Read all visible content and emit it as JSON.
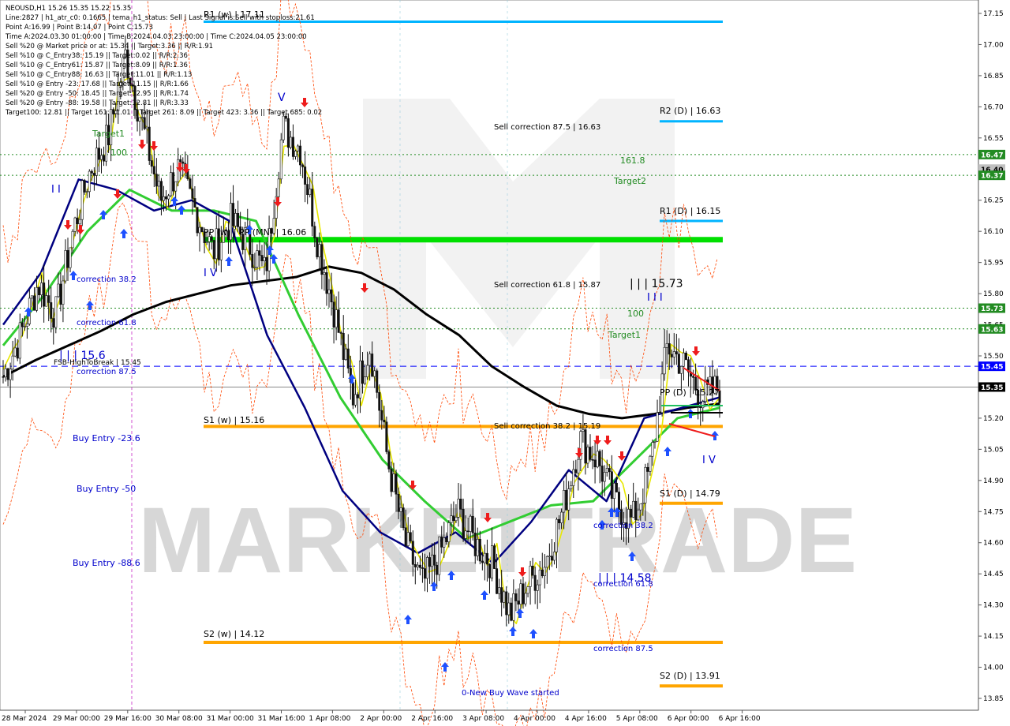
{
  "window": {
    "title": "NEOUSD,H1  15.26 15.35 15.22 15.35"
  },
  "info_lines": [
    "NEOUSD,H1  15.26 15.35 15.22 15.35",
    "Line:2827 | h1_atr_c0: 0.1665 | tema_h1_status: Sell | Last Signal is:Sell with stoploss:21.61",
    "Point A:16.99 | Point B:14.07 | Point C:15.73",
    "Time A:2024.03.30 01:00:00 | Time B:2024.04.03 23:00:00 | Time C:2024.04.05 23:00:00",
    "Sell %20 @ Market price or at: 15.34 || Target:3.36 || R/R:1.91",
    "Sell %10 @ C_Entry38: 15.19 || Target:0.02 || R/R:2.36",
    "Sell %10 @ C_Entry61: 15.87 || Target:8.09 || R/R:1.36",
    "Sell %10 @ C_Entry88: 16.63 || Target:11.01 || R/R:1.13",
    "Sell %10 @ Entry -23: 17.68 || Target:11.15 || R/R:1.66",
    "Sell %20 @ Entry -50: 18.45 || Target:12.95 || R/R:1.74",
    "Sell %20 @ Entry -88: 19.58 || Target:12.81 || R/R:3.33",
    "Target100: 12.81 || Target 161: 11.01 || Target 261: 8.09 || Target 423: 3.36 || Target 685: 0.02"
  ],
  "watermark": "MARKETTRADE",
  "colors": {
    "up": "#1a1a1a",
    "bg": "#ffffff",
    "orange": "#ffa500",
    "cyan": "#00b4ff",
    "green": "#00e000",
    "blue_label": "#0000cc",
    "green_label": "#228b22",
    "dashed_blue": "#0000ff",
    "ma_black": "#000000",
    "ma_navy": "#000080",
    "ma_green": "#32cd32",
    "ma_yellow": "#ffff00",
    "atr": "#ff4500"
  },
  "chart_data": {
    "type": "candlestick",
    "symbol": "NEOUSD",
    "timeframe": "H1",
    "ylim": [
      13.8,
      17.2
    ],
    "y_ticks": [
      "17.15",
      "17.00",
      "16.85",
      "16.70",
      "16.55",
      "16.40",
      "16.25",
      "16.10",
      "15.95",
      "15.80",
      "15.65",
      "15.50",
      "15.35",
      "15.20",
      "15.05",
      "14.90",
      "14.75",
      "14.60",
      "14.45",
      "14.30",
      "14.15",
      "14.00",
      "13.85"
    ],
    "x_ticks": [
      "28 Mar 2024",
      "29 Mar 00:00",
      "29 Mar 16:00",
      "30 Mar 08:00",
      "31 Mar 00:00",
      "31 Mar 16:00",
      "1 Apr 08:00",
      "2 Apr 00:00",
      "2 Apr 16:00",
      "3 Apr 08:00",
      "4 Apr 00:00",
      "4 Apr 16:00",
      "5 Apr 08:00",
      "6 Apr 00:00",
      "6 Apr 16:00"
    ],
    "price_tags": [
      {
        "text": "16.47",
        "value": 16.47,
        "color": "#228b22"
      },
      {
        "text": "16.40",
        "value": 16.4,
        "color": "#c0c0c0"
      },
      {
        "text": "16.37",
        "value": 16.37,
        "color": "#228b22"
      },
      {
        "text": "15.73",
        "value": 15.73,
        "color": "#228b22"
      },
      {
        "text": "15.63",
        "value": 15.63,
        "color": "#228b22"
      },
      {
        "text": "15.45",
        "value": 15.45,
        "color": "#0000ff"
      },
      {
        "text": "15.35",
        "value": 15.35,
        "color": "#000000"
      }
    ],
    "levels": [
      {
        "label": "R1 (w) | 17.11",
        "value": 17.11,
        "color": "#00b4ff"
      },
      {
        "label": "R2 (D) | 16.63",
        "value": 16.63,
        "color": "#00b4ff"
      },
      {
        "label": "R1 (D) | 16.15",
        "value": 16.15,
        "color": "#00b4ff"
      },
      {
        "label": "PP (w) | PP (MN) | 16.06",
        "value": 16.06,
        "color": "#00e000"
      },
      {
        "label": "S1 (w) | 15.16",
        "value": 15.16,
        "color": "#ffa500"
      },
      {
        "label": "S1 (D) | 14.79",
        "value": 14.79,
        "color": "#ffa500"
      },
      {
        "label": "S2 (w) | 14.12",
        "value": 14.12,
        "color": "#ffa500"
      },
      {
        "label": "S2 (D) | 13.91",
        "value": 13.91,
        "color": "#ffa500"
      }
    ],
    "dotted_levels": [
      16.47,
      16.37,
      15.73,
      15.63
    ],
    "dashed_level": 15.45,
    "current_price": 15.35,
    "annotations": {
      "sell_corr_875": "Sell correction 87.5 | 16.63",
      "sell_corr_618": "Sell correction 61.8 | 15.87",
      "sell_corr_382": "Sell correction 38.2 | 15.19",
      "target1_left": "Target1",
      "label_100_left": "100",
      "fib_1618": "161.8",
      "target2": "Target2",
      "wave_label": "| | | 15.73",
      "label_100_right": "100",
      "target1_right": "Target1",
      "pivot_ppd": "PP (D) | 15.27",
      "corr382_left": "correction 38.2",
      "corr618_left": "correction 61.8",
      "fsb": "FSB-HighToBreak | 15.45",
      "corr875_left": "correction 87.5",
      "wave_left": "| | | 15.6",
      "buy_236": "Buy Entry -23.6",
      "buy_50": "Buy Entry -50",
      "buy_886": "Buy Entry -88.6",
      "corr382_right": "correction 38.2",
      "corr618_right": "correction 61.8",
      "corr875_right": "correction 87.5",
      "wave_bottom": "| | | 14.58",
      "new_buy_wave": "0-New Buy Wave started",
      "iv_left": "I V",
      "iv_right": "I V",
      "v_top": "V",
      "ii_top": "I I",
      "iii_top": "I I I"
    },
    "close_series": [
      15.4,
      15.6,
      15.85,
      15.7,
      16.1,
      16.4,
      16.55,
      16.95,
      16.6,
      16.25,
      16.4,
      16.2,
      16.0,
      16.15,
      16.05,
      15.9,
      16.6,
      16.5,
      16.05,
      15.7,
      15.3,
      15.55,
      15.0,
      14.6,
      14.4,
      14.55,
      14.75,
      14.6,
      14.5,
      14.25,
      14.4,
      14.5,
      14.75,
      15.1,
      15.0,
      14.8,
      14.7,
      14.95,
      15.55,
      15.45,
      15.3,
      15.35
    ],
    "ema_black": [
      15.4,
      15.48,
      15.55,
      15.62,
      15.7,
      15.76,
      15.8,
      15.84,
      15.86,
      15.88,
      15.93,
      15.9,
      15.82,
      15.7,
      15.6,
      15.45,
      15.35,
      15.26,
      15.22,
      15.2,
      15.22,
      15.25,
      15.27
    ],
    "ema_navy": [
      15.65,
      15.9,
      16.35,
      16.3,
      16.2,
      16.25,
      16.15,
      15.6,
      15.25,
      14.85,
      14.65,
      14.55,
      14.65,
      14.5,
      14.7,
      14.95,
      14.8,
      15.2,
      15.25,
      15.3
    ],
    "ema_green": [
      15.55,
      15.8,
      16.1,
      16.3,
      16.2,
      16.2,
      16.15,
      15.7,
      15.3,
      15.0,
      14.8,
      14.62,
      14.7,
      14.78,
      14.8,
      15.0,
      15.2,
      15.25
    ]
  }
}
